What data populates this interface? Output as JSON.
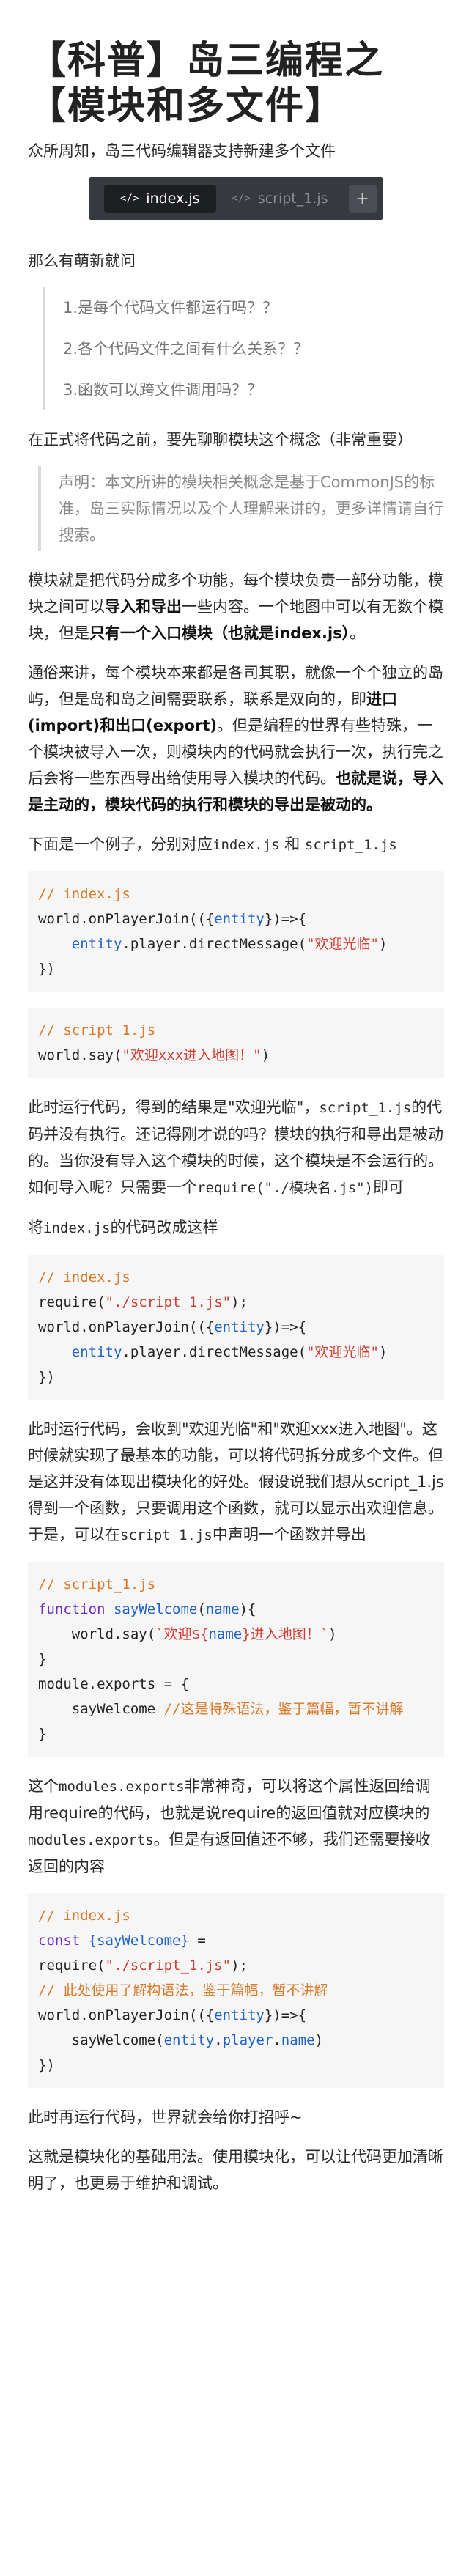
{
  "title": {
    "line1": "【科普】岛三编程之",
    "line2": "【模块和多文件】"
  },
  "intro": "众所周知，岛三代码编辑器支持新建多个文件",
  "tabs": [
    {
      "label": "index.js",
      "icon": "</>"
    },
    {
      "label": "script_1.js",
      "icon": "</>"
    },
    {
      "label": "+"
    }
  ],
  "questions_intro": "那么有萌新就问",
  "questions": [
    "1.是每个代码文件都运行吗？？",
    "2.各个代码文件之间有什么关系？？",
    "3.函数可以跨文件调用吗？？"
  ],
  "concept_intro": "在正式将代码之前，要先聊聊模块这个概念（非常重要）",
  "quote": "声明：本文所讲的模块相关概念是基于CommonJS的标准，岛三实际情况以及个人理解来讲的，更多详情请自行搜索。",
  "para1": {
    "t1": "模块就是把代码分成多个功能，每个模块负责一部分功能，模块之间可以",
    "b1": "导入和导出",
    "t2": "一些内容。一个地图中可以有无数个模块，但是",
    "b2": "只有一个入口模块（也就是index.js）",
    "t3": "。"
  },
  "para2": {
    "t1": "通俗来讲，每个模块本来都是各司其职，就像一个个独立的岛屿，但是岛和岛之间需要联系，联系是双向的，即",
    "b1": "进口(import)和出口(export)",
    "t2": "。但是编程的世界有些特殊，一个模块被导入一次，则模块内的代码就会执行一次，执行完之后会将一些东西导出给使用导入模块的代码。",
    "b2": "也就是说，导入是主动的，模块代码的执行和模块的导出是被动的。"
  },
  "example_intro": {
    "t1": "下面是一个例子，分别对应",
    "c1": "index.js",
    "t2": " 和 ",
    "c2": "script_1.js"
  },
  "code1": {
    "l1": "// index.js",
    "l2a": "world.onPlayerJoin(({",
    "l2b": "entity",
    "l2c": "})=>{",
    "l3a": "    ",
    "l3b": "entity",
    "l3c": ".player.directMessage(",
    "l3d": "\"欢迎光临\"",
    "l3e": ")",
    "l4": "})"
  },
  "code2": {
    "l1": "// script_1.js",
    "l2a": "world.say(",
    "l2b": "\"欢迎xxx进入地图！\"",
    "l2c": ")"
  },
  "para3": {
    "t1": "此时运行代码，得到的结果是\"欢迎光临\"，",
    "c1": "script_1.js",
    "t2": "的代码并没有执行。还记得刚才说的吗？模块的执行和导出是被动的。当你没有导入这个模块的时候，这个模块是不会运行的。如何导入呢？只需要一个",
    "c2": "require(\"./模块名.js\")",
    "t3": "即可"
  },
  "para4": {
    "t1": "将",
    "c1": "index.js",
    "t2": "的代码改成这样"
  },
  "code3": {
    "l1": "// index.js",
    "l2a": "require(",
    "l2b": "\"./script_1.js\"",
    "l2c": ");",
    "l3a": "world.onPlayerJoin(({",
    "l3b": "entity",
    "l3c": "})=>{",
    "l4a": "    ",
    "l4b": "entity",
    "l4c": ".player.directMessage(",
    "l4d": "\"欢迎光临\"",
    "l4e": ")",
    "l5": "})"
  },
  "para5": {
    "t1": "此时运行代码，会收到\"欢迎光临\"和\"欢迎xxx进入地图\"。这时候就实现了最基本的功能，可以将代码拆分成多个文件。但是这并没有体现出模块化的好处。假设说我们想从script_1.js得到一个函数，只要调用这个函数，就可以显示出欢迎信息。于是，可以在",
    "c1": "script_1.js",
    "t2": "中声明一个函数并导出"
  },
  "code4": {
    "l1": "// script_1.js",
    "l2a": "function ",
    "l2b": "sayWelcome",
    "l2c": "(",
    "l2d": "name",
    "l2e": "){",
    "l3a": "    world.say(",
    "l3b": "`欢迎${",
    "l3c": "name",
    "l3d": "}进入地图！`",
    "l3e": ")",
    "l4": "}",
    "l5": "module.exports = {",
    "l6a": "    sayWelcome ",
    "l6b": "//这是特殊语法，鉴于篇幅，暂不讲解",
    "l7": "}"
  },
  "para6": {
    "t1": "这个",
    "c1": "modules.exports",
    "t2": "非常神奇，可以将这个属性返回给调用require的代码，也就是说require的返回值就对应模块的",
    "c2": "modules.exports",
    "t3": "。但是有返回值还不够，我们还需要接收返回的内容"
  },
  "code5": {
    "l1": "// index.js",
    "l2a": "const ",
    "l2b": "{sayWelcome}",
    "l2c": " =",
    "l3a": "require(",
    "l3b": "\"./script_1.js\"",
    "l3c": ");",
    "l4": "// 此处使用了解构语法，鉴于篇幅，暂不讲解",
    "l5a": "world.onPlayerJoin(({",
    "l5b": "entity",
    "l5c": "})=>{",
    "l6a": "    sayWelcome(",
    "l6b": "entity",
    "l6c": ".",
    "l6d": "player",
    "l6e": ".",
    "l6f": "name",
    "l6g": ")",
    "l7": "})"
  },
  "para7": "此时再运行代码，世界就会给你打招呼~",
  "para8": "这就是模块化的基础用法。使用模块化，可以让代码更加清晰明了，也更易于维护和调试。",
  "colors": {
    "comment": "#d87a2a",
    "string": "#d13c2e",
    "keyword": "#6f2fc0",
    "param": "#1f63c6",
    "tabbar": "#36393d"
  }
}
